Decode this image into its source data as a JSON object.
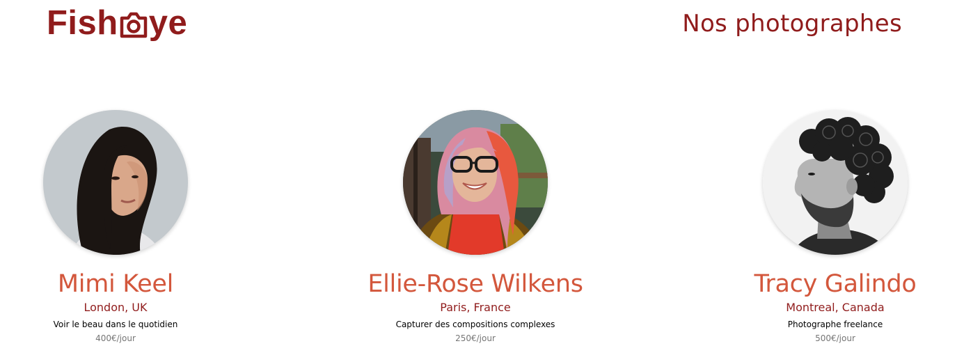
{
  "header": {
    "logo": {
      "text_before": "Fish",
      "text_after": "ye",
      "icon": "camera-icon"
    },
    "title": "Nos photographes"
  },
  "colors": {
    "brand": "#901c1c",
    "name": "#d3573c",
    "price": "#757575"
  },
  "photographers": [
    {
      "name": "Mimi Keel",
      "location": "London, UK",
      "tagline": "Voir le beau dans le quotidien",
      "price": "400€/jour",
      "portrait_icon": "portrait-mimi"
    },
    {
      "name": "Ellie-Rose Wilkens",
      "location": "Paris, France",
      "tagline": "Capturer des compositions complexes",
      "price": "250€/jour",
      "portrait_icon": "portrait-ellie"
    },
    {
      "name": "Tracy Galindo",
      "location": "Montreal, Canada",
      "tagline": "Photographe freelance",
      "price": "500€/jour",
      "portrait_icon": "portrait-tracy"
    }
  ]
}
